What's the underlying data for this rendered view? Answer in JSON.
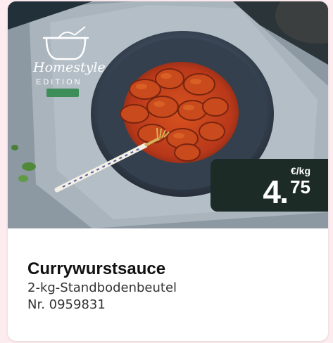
{
  "product": {
    "name": "Currywurstsauce",
    "package": "2-kg-Standbodenbeutel",
    "article_number": "Nr. 0959831",
    "brand_logo_text": "Homestyle",
    "brand_logo_sub": "EDITION"
  },
  "price": {
    "unit": "€/kg",
    "integer": "4",
    "decimals": "75"
  },
  "colors": {
    "page_background": "#fdecef",
    "badge_background": "#1c2b26",
    "badge_text": "#ffffff"
  },
  "icons": [
    "pot-logo-icon"
  ]
}
